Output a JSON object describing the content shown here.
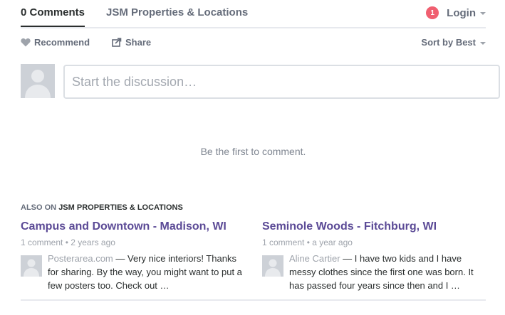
{
  "nav": {
    "comments_tab": "0 Comments",
    "community_tab": "JSM Properties & Locations",
    "notification_count": "1",
    "login_label": "Login"
  },
  "actions": {
    "recommend_label": "Recommend",
    "share_label": "Share",
    "sort_label": "Sort by Best"
  },
  "compose": {
    "placeholder": "Start the discussion…"
  },
  "empty_message": "Be the first to comment.",
  "also_on": {
    "prefix": "ALSO ON",
    "site": "JSM PROPERTIES & LOCATIONS"
  },
  "cards": [
    {
      "title": "Campus and Downtown - Madison, WI",
      "comments": "1 comment",
      "age": "2 years ago",
      "author": "Posterarea.com",
      "excerpt": "Very nice interiors! Thanks for sharing. By the way, you might want to put a few posters too. Check out …"
    },
    {
      "title": "Seminole Woods - Fitchburg, WI",
      "comments": "1 comment",
      "age": "a year ago",
      "author": "Aline Cartier",
      "excerpt": "I have two kids and I have messy clothes since the first one was born. It has passed four years since then and I …"
    }
  ],
  "colors": {
    "accent": "#5b4a96",
    "badge": "#f05f70",
    "muted": "#656c7a"
  }
}
